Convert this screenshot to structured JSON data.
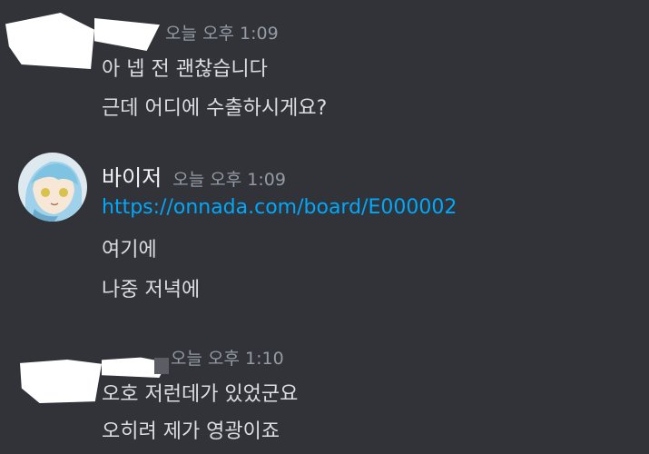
{
  "colors": {
    "background": "#313338",
    "message_text": "#dbdee1",
    "timestamp": "#949ba4",
    "username": "#f2f3f5",
    "link": "#00a8fc"
  },
  "groups": [
    {
      "username": "",
      "timestamp": "오늘 오후 1:09",
      "lines": [
        "아 넵 전 괜찮습니다",
        "근데 어디에 수출하시게요?"
      ]
    },
    {
      "username": "바이저",
      "timestamp": "오늘 오후 1:09",
      "avatar_icon": "anime-character-avatar",
      "link": "https://onnada.com/board/E000002",
      "lines": [
        "여기에",
        "나중 저녁에"
      ]
    },
    {
      "username": "",
      "timestamp": "오늘 오후 1:10",
      "lines": [
        "오호 저런데가 있었군요",
        "오히려 제가 영광이죠"
      ]
    }
  ]
}
